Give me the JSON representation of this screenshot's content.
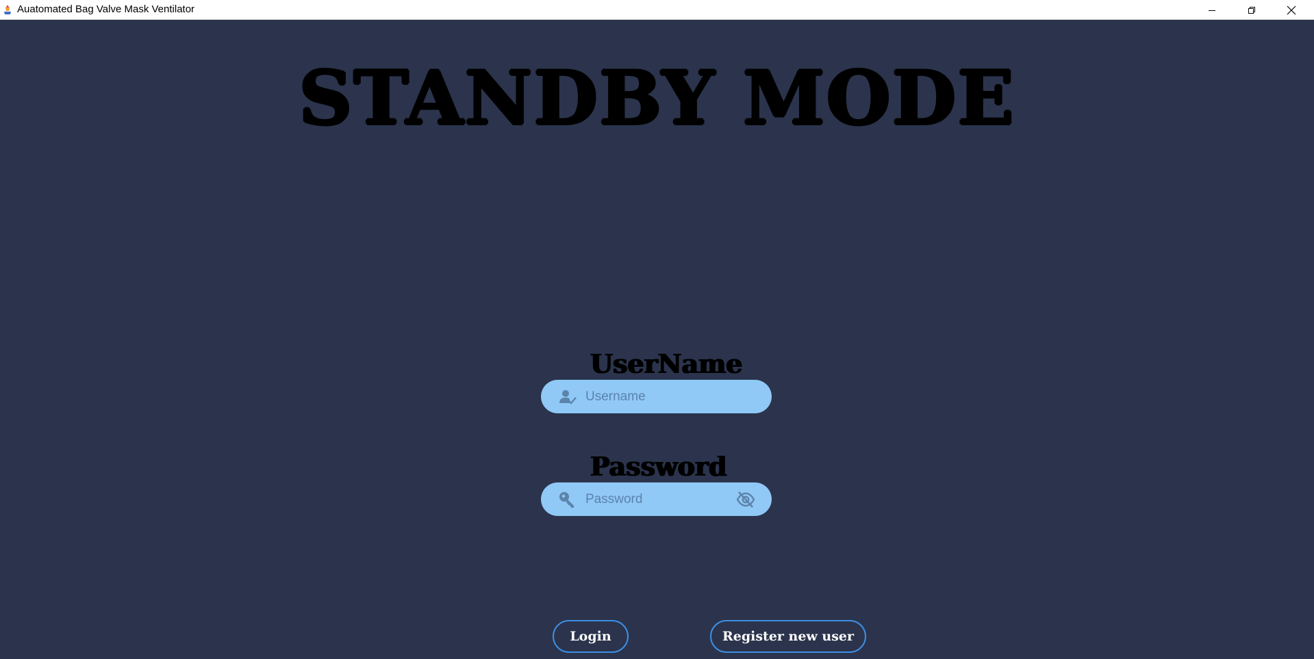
{
  "window": {
    "title": "Auatomated Bag Valve Mask Ventilator",
    "controls": [
      "minimize-icon",
      "restore-icon",
      "close-icon"
    ]
  },
  "main": {
    "mode_title": "STANDBY MODE",
    "username": {
      "label": "UserName",
      "placeholder": "Username",
      "value": "",
      "icon": "user-check-icon"
    },
    "password": {
      "label": "Password",
      "placeholder": "Password",
      "value": "",
      "icon": "key-icon",
      "toggle_icon": "eye-off-icon"
    },
    "buttons": {
      "login_label": "Login",
      "register_label": "Register new user"
    }
  },
  "colors": {
    "background": "#2b344c",
    "field_fill": "#90c8f6",
    "button_border": "#3d8fe6",
    "icon": "#5c84ab"
  }
}
